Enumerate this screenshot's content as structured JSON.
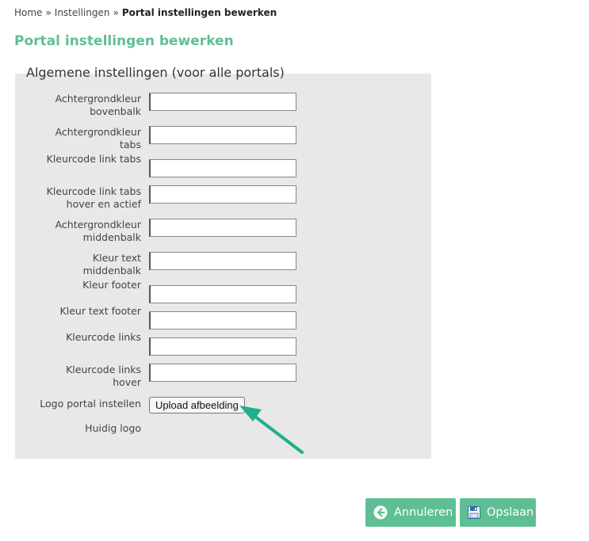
{
  "breadcrumb": {
    "items": [
      "Home",
      "Instellingen"
    ],
    "separator": "»",
    "current": "Portal instellingen bewerken"
  },
  "page": {
    "title": "Portal instellingen bewerken"
  },
  "form": {
    "legend": "Algemene instellingen (voor alle portals)",
    "fields": [
      {
        "label_lines": [
          "Achtergrondkleur",
          "bovenbalk"
        ]
      },
      {
        "label_lines": [
          "Achtergrondkleur",
          "tabs"
        ]
      },
      {
        "label_lines": [
          "Kleurcode link tabs"
        ]
      },
      {
        "label_lines": [
          "Kleurcode link tabs",
          "hover en actief"
        ]
      },
      {
        "label_lines": [
          "Achtergrondkleur",
          "middenbalk"
        ]
      },
      {
        "label_lines": [
          "Kleur text",
          "middenbalk"
        ]
      },
      {
        "label_lines": [
          "Kleur footer"
        ]
      },
      {
        "label_lines": [
          "Kleur text footer"
        ]
      },
      {
        "label_lines": [
          "Kleurcode links"
        ]
      },
      {
        "label_lines": [
          "Kleurcode links",
          "hover"
        ]
      }
    ],
    "logo_label": "Logo portal instellen",
    "upload_button": "Upload afbeelding",
    "current_logo_label": "Huidig logo"
  },
  "actions": {
    "cancel_label": "Annuleren",
    "save_label": "Opslaan"
  },
  "icons": {
    "cancel": "arrow-left-circle-icon",
    "save": "floppy-disk-icon",
    "annotation": "annotation-arrow-icon"
  },
  "colors": {
    "accent": "#5fbf94",
    "panel": "#e8e8e8",
    "annotation_arrow": "#1fae8f"
  }
}
